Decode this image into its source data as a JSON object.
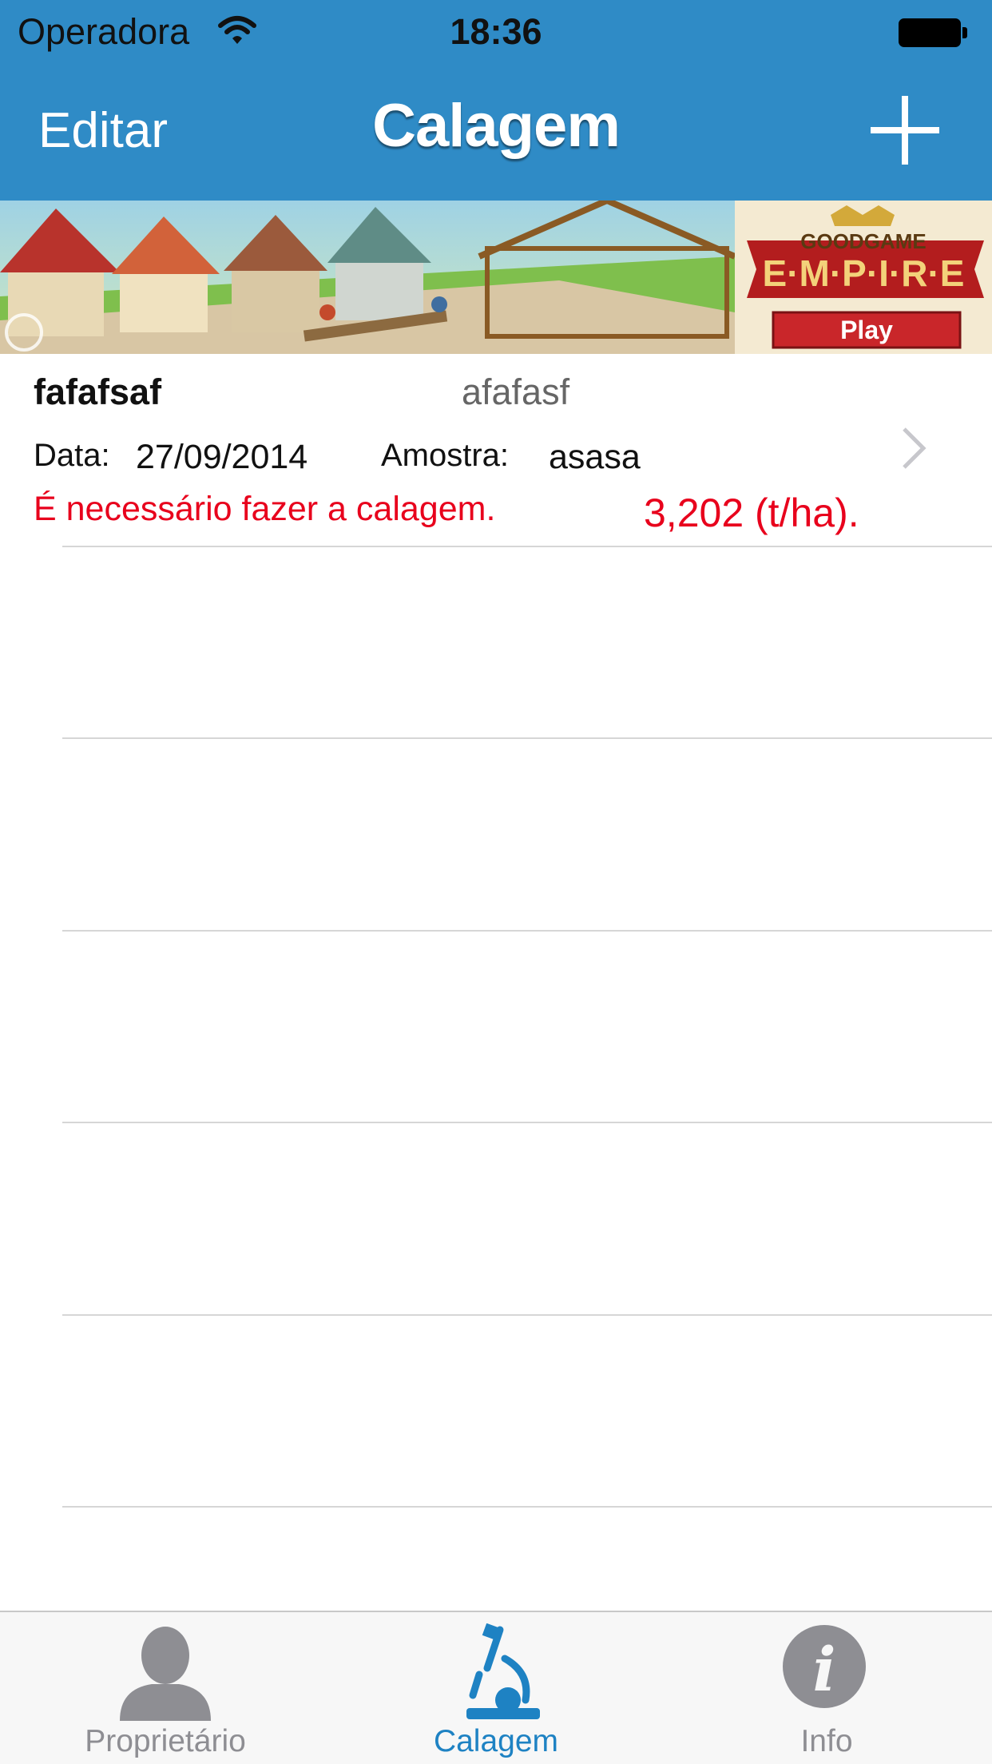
{
  "status_bar": {
    "carrier": "Operadora",
    "time": "18:36",
    "wifi_icon": "wifi-icon",
    "battery_icon": "battery-full-icon"
  },
  "nav_bar": {
    "edit_label": "Editar",
    "title": "Calagem",
    "add_icon": "plus-icon"
  },
  "ad_banner": {
    "brand_top": "GOODGAME",
    "brand_main": "E·M·P·I·R·E",
    "cta": "Play"
  },
  "list": {
    "items": [
      {
        "title": "fafafsaf",
        "subtitle": "afafasf",
        "date_label": "Data:",
        "date": "27/09/2014",
        "sample_label": "Amostra:",
        "sample": "asasa",
        "status": "É necessário fazer a calagem.",
        "result": "3,202 (t/ha).",
        "status_color": "#e8001c",
        "disclosure_icon": "chevron-right-icon"
      }
    ]
  },
  "tab_bar": {
    "tabs": [
      {
        "label": "Proprietário",
        "icon": "person-icon",
        "active": false
      },
      {
        "label": "Calagem",
        "icon": "microscope-icon",
        "active": true
      },
      {
        "label": "Info",
        "icon": "info-icon",
        "active": false
      }
    ],
    "active_color": "#1e82c3",
    "inactive_color": "#8e8e93"
  },
  "colors": {
    "nav_background": "#2f8bc6",
    "accent": "#1e82c3"
  }
}
